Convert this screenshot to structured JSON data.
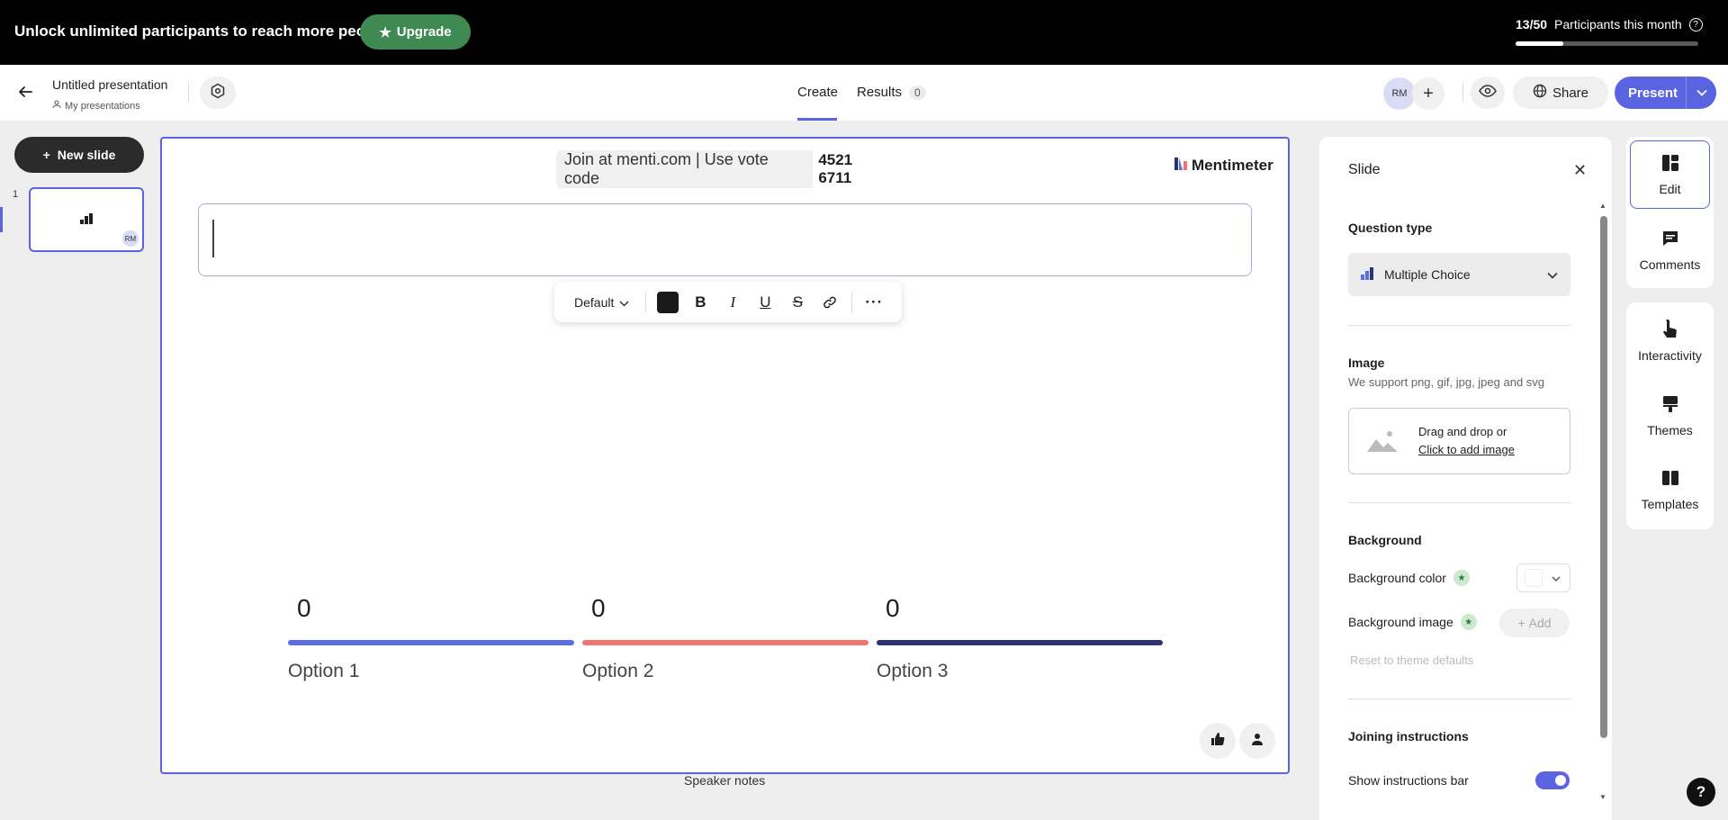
{
  "banner": {
    "message": "Unlock unlimited participants to reach more people.",
    "upgrade_label": "Upgrade",
    "participants_count": "13/50",
    "participants_label": "Participants this month",
    "participants_progress": 0.26
  },
  "header": {
    "presentation_title": "Untitled presentation",
    "folder_label": "My presentations",
    "tabs": [
      {
        "label": "Create",
        "active": true
      },
      {
        "label": "Results",
        "badge": "0"
      }
    ],
    "avatar_initials": "RM",
    "share_label": "Share",
    "present_label": "Present"
  },
  "sidebar": {
    "new_slide_label": "New slide",
    "slides": [
      {
        "number": "1",
        "avatar": "RM"
      }
    ]
  },
  "canvas": {
    "join_text": "Join at menti.com | Use vote code",
    "vote_code": "4521 6711",
    "brand": "Mentimeter",
    "format_style": "Default",
    "options": [
      {
        "label": "Option 1",
        "value": "0",
        "color": "#5a6ee4"
      },
      {
        "label": "Option 2",
        "value": "0",
        "color": "#f07470"
      },
      {
        "label": "Option 3",
        "value": "0",
        "color": "#2e3178"
      }
    ],
    "speaker_notes_label": "Speaker notes"
  },
  "panel": {
    "title": "Slide",
    "question_type_heading": "Question type",
    "question_type_value": "Multiple Choice",
    "image_heading": "Image",
    "image_subtitle": "We support png, gif, jpg, jpeg and svg",
    "drop_text": "Drag and drop or",
    "drop_link": "Click to add image",
    "background_heading": "Background",
    "background_color_label": "Background color",
    "background_image_label": "Background image",
    "add_label": "Add",
    "reset_label": "Reset to theme defaults",
    "joining_heading": "Joining instructions",
    "show_instructions_label": "Show instructions bar",
    "show_instructions_on": true
  },
  "rail": {
    "items": [
      {
        "label": "Edit",
        "icon": "edit-icon"
      },
      {
        "label": "Comments",
        "icon": "comments-icon"
      },
      {
        "label": "Interactivity",
        "icon": "interactivity-icon"
      },
      {
        "label": "Themes",
        "icon": "themes-icon"
      },
      {
        "label": "Templates",
        "icon": "templates-icon"
      }
    ]
  },
  "colors": {
    "accent": "#5a64e0",
    "upgrade_green": "#3f8a53"
  }
}
